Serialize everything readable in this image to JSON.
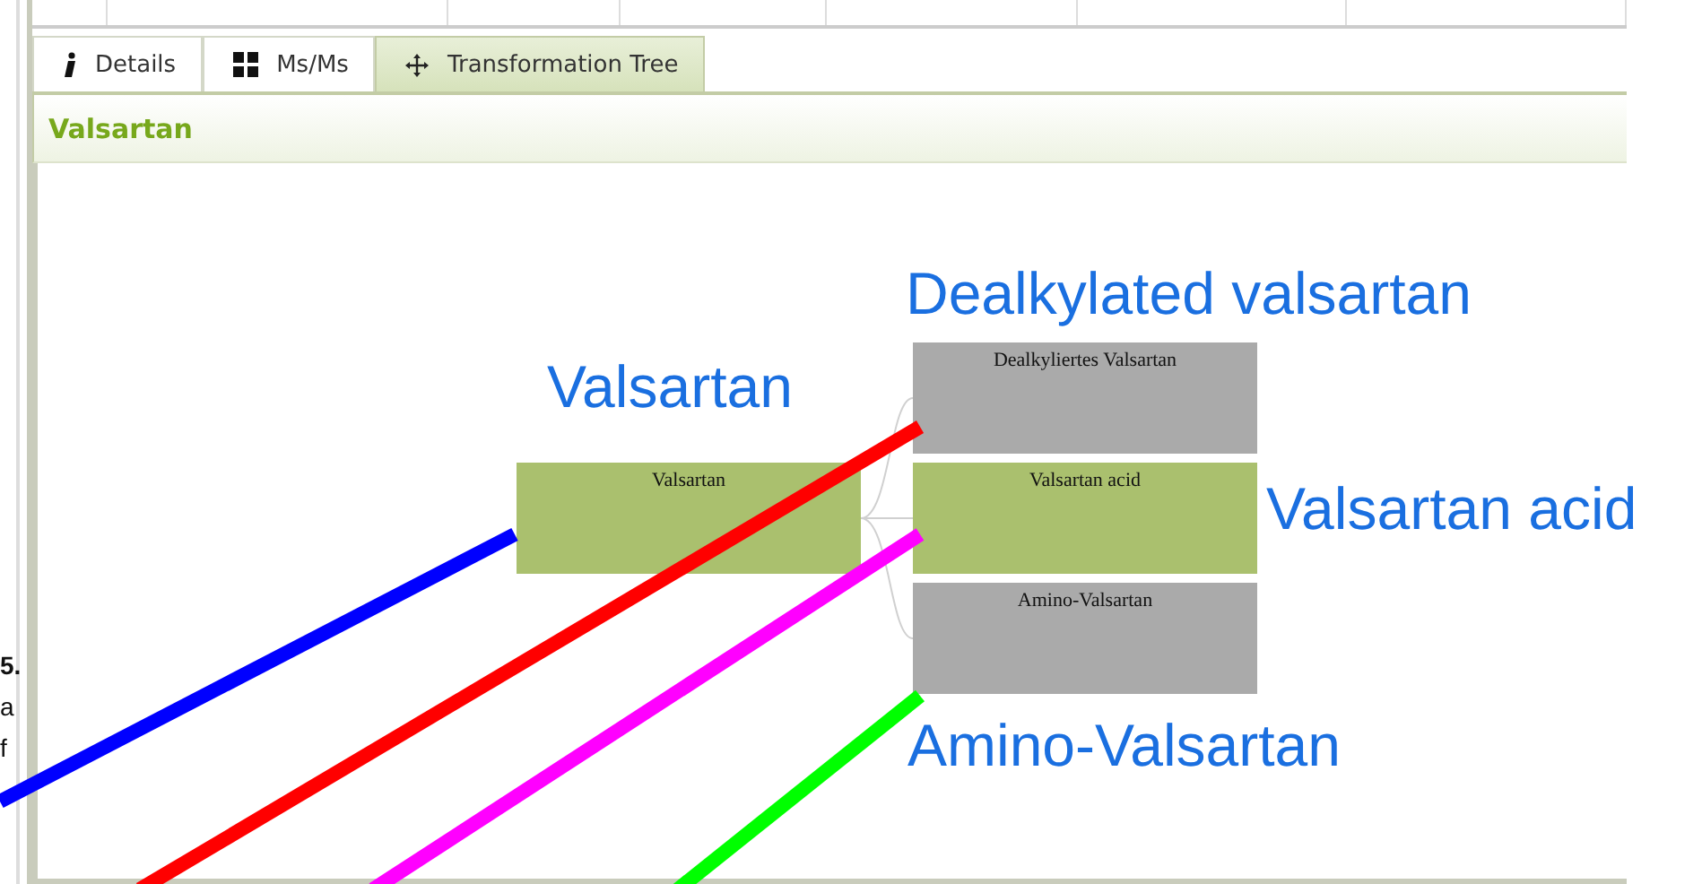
{
  "tabs": [
    {
      "label": "Details",
      "kind": "info",
      "selected": false
    },
    {
      "label": "Ms/Ms",
      "kind": "grid",
      "selected": false
    },
    {
      "label": "Transformation Tree",
      "kind": "move",
      "selected": true
    }
  ],
  "panel_title": "Valsartan",
  "tree": {
    "label": "Valsartan",
    "color": "#aac06e",
    "children": [
      {
        "label": "Dealkyliertes Valsartan",
        "color": "#aaaaaa"
      },
      {
        "label": "Valsartan acid",
        "color": "#aac06e"
      },
      {
        "label": "Amino-Valsartan",
        "color": "#aaaaaa"
      }
    ]
  },
  "annotations": [
    {
      "text": "Valsartan",
      "color": "#0000ff"
    },
    {
      "text": "Dealkylated valsartan",
      "color": "#ff0000"
    },
    {
      "text": "Valsartan acid",
      "color": "#ff00ff"
    },
    {
      "text": "Amino-Valsartan",
      "color": "#00ff00"
    }
  ],
  "side_text": [
    "5.",
    "a",
    "f"
  ]
}
